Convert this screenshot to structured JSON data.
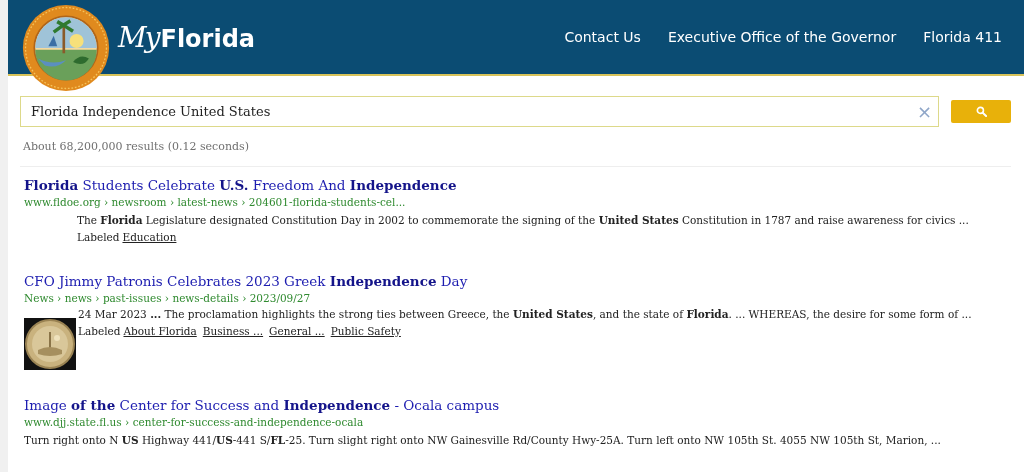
{
  "header": {
    "brand_script": "My",
    "brand_name": "Florida",
    "nav": [
      "Contact Us",
      "Executive Office of the Governor",
      "Florida 411"
    ]
  },
  "search": {
    "value": "Florida Independence United States",
    "clear_icon": "×"
  },
  "results_info": "About 68,200,000 results (0.12 seconds)",
  "results": [
    {
      "title": "**Florida** Students Celebrate **U.S.** Freedom And **Independence**",
      "url": "www.fldoe.org › newsroom › latest-news › 204601-florida-students-cel...",
      "snippet": "The **Florida** Legislature designated Constitution Day in 2002 to commemorate the signing of the **United States** Constitution in 1787 and raise awareness for civics ...",
      "labels_prefix": "Labeled",
      "labels": [
        "Education"
      ]
    },
    {
      "title": "CFO Jimmy Patronis Celebrates 2023 Greek **Independence** Day",
      "url": "News › news › past-issues › news-details › 2023/09/27",
      "snippet": "24 Mar 2023 **...** The proclamation highlights the strong ties between Greece, the **United States**, and the state of **Florida**. ... WHEREAS, the desire for some form of ...",
      "labels_prefix": "Labeled",
      "labels": [
        "About Florida",
        "Business ...",
        "General ...",
        "Public Safety"
      ]
    },
    {
      "title": "Image **of the** Center for Success and **Independence** - Ocala campus",
      "url": "www.djj.state.fl.us › center-for-success-and-independence-ocala",
      "snippet": "Turn right onto N **US** Highway 441/**US**-441 S/**FL**-25. Turn slight right onto NW Gainesville Rd/County Hwy-25A. Turn left onto NW 105th St. 4055 NW 105th St, Marion, ..."
    }
  ]
}
